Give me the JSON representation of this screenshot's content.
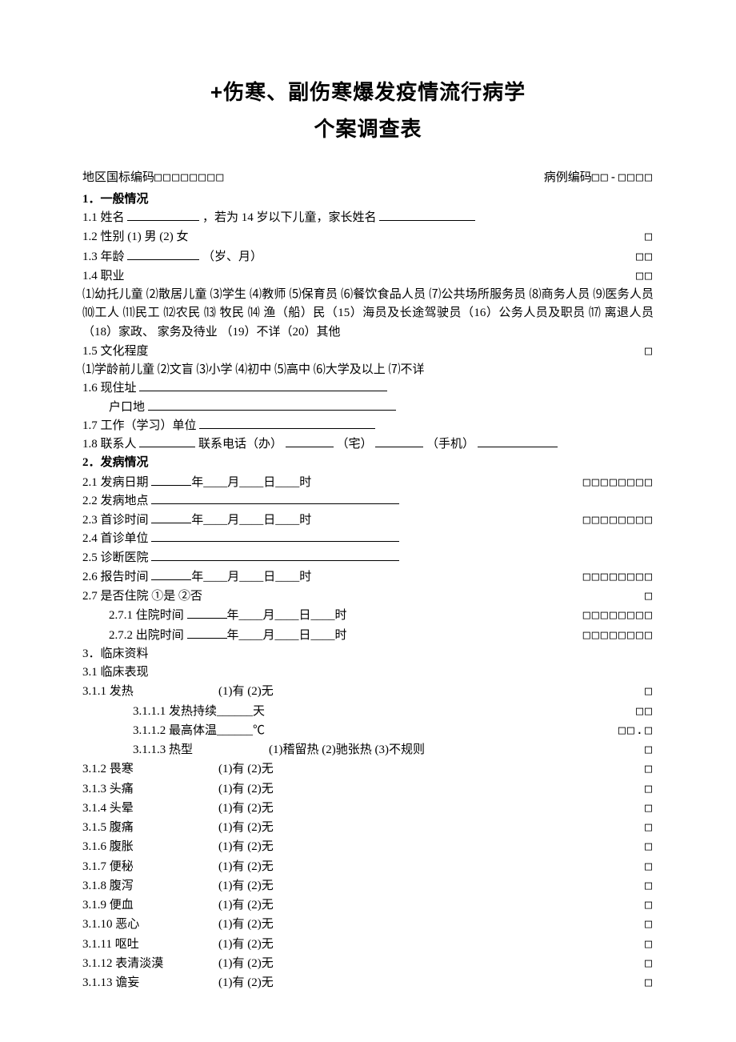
{
  "title_line1": "+伤寒、副伤寒爆发疫情流行病学",
  "title_line2": "个案调查表",
  "region_code_label": "地区国标编码",
  "region_code_boxes": "□□□□□□□□",
  "case_code_label": "病例编码",
  "case_code_boxes": "□□-□□□□",
  "s1": {
    "head": "1．一般情况",
    "f1_1a": "1.1 姓名",
    "f1_1b": "，若为 14 岁以下儿童，家长姓名",
    "f1_2": "1.2 性别 (1) 男 (2) 女",
    "f1_3a": "1.3 年龄",
    "f1_3b": "（岁、月）",
    "f1_4": "1.4 职业",
    "f1_4_opts": "⑴幼托儿童 ⑵散居儿童 ⑶学生 ⑷教师 ⑸保育员 ⑹餐饮食品人员 ⑺公共场所服务员 ⑻商务人员 ⑼医务人员 ⑽工人 ⑾民工 ⑿农民  ⒀ 牧民 ⒁ 渔（船）民（15）海员及长途驾驶员（16）公务人员及职员 ⒄ 离退人员 （18）家政、 家务及待业 （19）不详（20）其他",
    "f1_5": "1.5 文化程度",
    "f1_5_opts": "⑴学龄前儿童 ⑵文盲 ⑶小学 ⑷初中 ⑸高中 ⑹大学及以上  ⑺不详",
    "f1_6a": "1.6 现住址",
    "f1_6b": "户口地",
    "f1_7": "1.7 工作（学习）单位",
    "f1_8a": "1.8 联系人",
    "f1_8b": "联系电话（办）",
    "f1_8c": "（宅）",
    "f1_8d": "（手机）"
  },
  "s2": {
    "head": "2．发病情况",
    "f2_1": "2.1 发病日期",
    "date_suffix_ymd_h": "年____月____日____时",
    "f2_2": "2.2 发病地点",
    "f2_3": "2.3 首诊时间",
    "f2_4": "2.4 首诊单位",
    "f2_5": "2.5 诊断医院",
    "f2_6": "2.6 报告时间",
    "f2_7": "2.7 是否住院   ①是     ②否",
    "f2_7_1": "2.7.1 住院时间",
    "f2_7_2": "2.7.2 出院时间",
    "box8": "□□□□□□□□",
    "box1": "□"
  },
  "s3": {
    "head": "3．临床资料",
    "f3_1": "3.1 临床表现",
    "items": [
      {
        "num": "3.1.1",
        "label": "发热",
        "opts": "(1)有    (2)无",
        "box": "□"
      },
      {
        "num": "3.1.1.1",
        "label": "发热持续______天",
        "opts": "",
        "box": "□□",
        "indent": 2
      },
      {
        "num": "3.1.1.2",
        "label": "最高体温______℃",
        "opts": "",
        "box": "□□.□",
        "indent": 2
      },
      {
        "num": "3.1.1.3",
        "label": "热型",
        "opts": "(1)稽留热  (2)驰张热  (3)不规则",
        "box": "□",
        "indent": 2
      },
      {
        "num": "3.1.2",
        "label": "畏寒",
        "opts": "(1)有    (2)无",
        "box": "□"
      },
      {
        "num": "3.1.3",
        "label": "头痛",
        "opts": "(1)有    (2)无",
        "box": "□"
      },
      {
        "num": "3.1.4",
        "label": "头晕",
        "opts": "(1)有    (2)无",
        "box": "□"
      },
      {
        "num": "3.1.5",
        "label": "腹痛",
        "opts": "(1)有    (2)无",
        "box": "□"
      },
      {
        "num": "3.1.6",
        "label": "腹胀",
        "opts": "(1)有    (2)无",
        "box": "□"
      },
      {
        "num": "3.1.7",
        "label": "便秘",
        "opts": "(1)有    (2)无",
        "box": "□"
      },
      {
        "num": "3.1.8",
        "label": "腹泻",
        "opts": "(1)有    (2)无",
        "box": "□"
      },
      {
        "num": "3.1.9",
        "label": "便血",
        "opts": "(1)有    (2)无",
        "box": "□"
      },
      {
        "num": "3.1.10",
        "label": "恶心",
        "opts": "(1)有    (2)无",
        "box": "□"
      },
      {
        "num": "3.1.11",
        "label": "呕吐",
        "opts": "(1)有    (2)无",
        "box": "□"
      },
      {
        "num": "3.1.12",
        "label": "表清淡漠",
        "opts": "(1)有    (2)无",
        "box": "□"
      },
      {
        "num": "3.1.13",
        "label": "谵妄",
        "opts": "(1)有    (2)无",
        "box": "□"
      }
    ]
  }
}
